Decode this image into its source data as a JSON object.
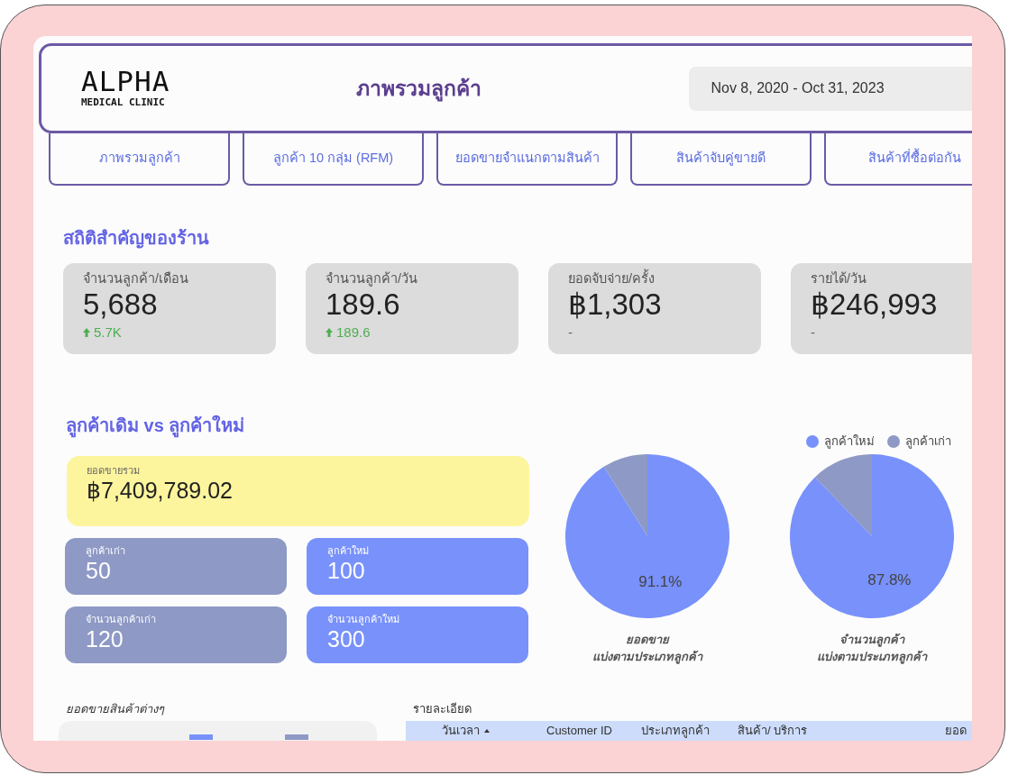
{
  "header": {
    "logo": {
      "name": "ALPHA",
      "tagline": "MEDICAL CLINIC"
    },
    "title": "ภาพรวมลูกค้า",
    "date_range": {
      "value": "Nov 8, 2020 - Oct 31, 2023"
    }
  },
  "nav_tabs": [
    {
      "label": "ภาพรวมลูกค้า"
    },
    {
      "label": "ลูกค้า 10 กลุ่ม (RFM)"
    },
    {
      "label": "ยอดขายจำแนกตามสินค้า"
    },
    {
      "label": "สินค้าจับคู่ขายดี"
    },
    {
      "label": "สินค้าที่ซื้อต่อกัน"
    }
  ],
  "key_stats": {
    "title": "สถิติสำคัญของร้าน",
    "cards": [
      {
        "label": "จำนวนลูกค้า/เดือน",
        "value": "5,688",
        "change": {
          "text": "5.7K",
          "increase": true
        }
      },
      {
        "label": "จำนวนลูกค้า/วัน",
        "value": "189.6",
        "change": {
          "text": "189.6",
          "increase": true
        }
      },
      {
        "label": "ยอดจับจ่าย/ครั้ง",
        "value": "฿1,303",
        "change": {
          "text": "-",
          "increase": false
        }
      },
      {
        "label": "รายได้/วัน",
        "value": "฿246,993",
        "change": {
          "text": "-",
          "increase": false
        }
      }
    ]
  },
  "customer_split": {
    "title": "ลูกค้าเดิม vs ลูกค้าใหม่",
    "total_sales": {
      "label": "ยอดขายรวม",
      "value": "฿7,409,789.02"
    },
    "tiles": [
      {
        "kind": "returning",
        "label": "ลูกค้าเก่า",
        "value": "50"
      },
      {
        "kind": "new",
        "label": "ลูกค้าใหม่",
        "value": "100"
      },
      {
        "kind": "returning",
        "label": "จำนวนลูกค้าเก่า",
        "value": "120"
      },
      {
        "kind": "new",
        "label": "จำนวนลูกค้าใหม่",
        "value": "300"
      }
    ],
    "legend": [
      {
        "label": "ลูกค้าใหม่",
        "color": "#7891fb"
      },
      {
        "label": "ลูกค้าเก่า",
        "color": "#8e99c5"
      }
    ],
    "charts": [
      {
        "chart_data": {
          "type": "pie",
          "title": "ยอดขาย\nแบ่งตามประเภทลูกค้า",
          "values": [
            91.1,
            8.9
          ]
        },
        "slice_label": "91.1%"
      },
      {
        "chart_data": {
          "type": "pie",
          "title": "จำนวนลูกค้า\nแบ่งตามประเภทลูกค้า",
          "values": [
            87.8,
            12.2
          ]
        },
        "slice_label": "87.8%"
      }
    ]
  },
  "product_sales": {
    "title": "ยอดขายสินค้าต่างๆ",
    "legend": [
      {
        "color": "#7891fb"
      },
      {
        "color": "#8e99c5"
      }
    ]
  },
  "details": {
    "title": "รายละเอียด",
    "columns": [
      {
        "label": "วันเวลา",
        "sorted_ascending": true
      },
      {
        "label": "Customer ID",
        "sorted_ascending": false
      },
      {
        "label": "ประเภทลูกค้า",
        "sorted_ascending": false
      },
      {
        "label": "สินค้า/ บริการ",
        "sorted_ascending": false
      },
      {
        "label": "ยอด",
        "sorted_ascending": false
      }
    ]
  }
}
